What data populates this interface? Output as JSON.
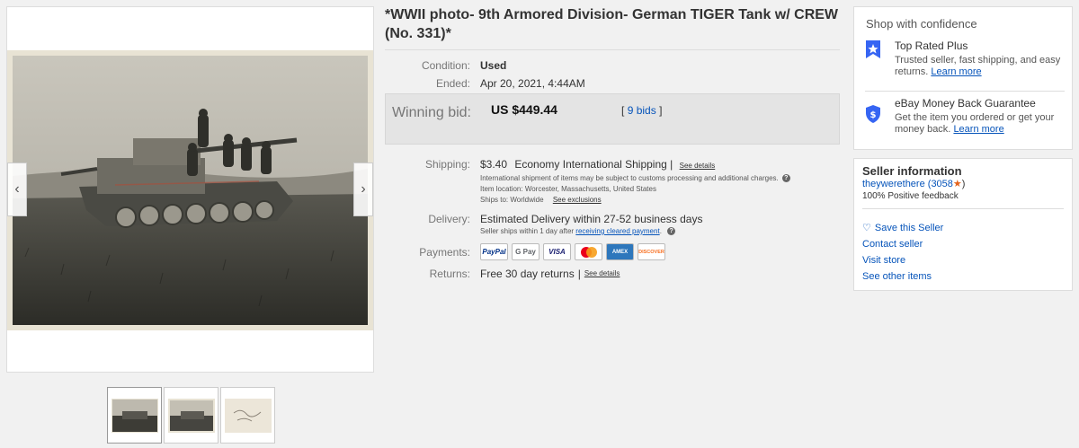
{
  "listing": {
    "title": "*WWII photo- 9th Armored Division- German TIGER Tank w/ CREW (No. 331)*"
  },
  "details": {
    "condition_label": "Condition:",
    "condition_value": "Used",
    "ended_label": "Ended:",
    "ended_value": "Apr 20, 2021, 4:44AM",
    "winning_bid_label": "Winning bid:",
    "winning_bid_value": "US $449.44",
    "bids_open": "[",
    "bids_link": "9 bids",
    "bids_close": "]",
    "shipping_label": "Shipping:",
    "shipping_price": "$3.40",
    "shipping_method": "Economy International Shipping",
    "shipping_sep": "|",
    "shipping_details_link": "See details",
    "shipping_note": "International shipment of items may be subject to customs processing and additional charges.",
    "item_location_label": "Item location:",
    "item_location_value": "Worcester, Massachusetts, United States",
    "ships_to_label": "Ships to:",
    "ships_to_value": "Worldwide",
    "exclusions_link": "See exclusions",
    "delivery_label": "Delivery:",
    "delivery_value": "Estimated Delivery within 27-52 business days",
    "delivery_note_prefix": "Seller ships within 1 day after",
    "delivery_note_link": "receiving cleared payment",
    "delivery_note_suffix": ".",
    "payments_label": "Payments:",
    "payment_methods": [
      "PayPal",
      "G Pay",
      "VISA",
      "Mastercard",
      "AMEX",
      "DISCOVER"
    ],
    "returns_label": "Returns:",
    "returns_value": "Free 30 day returns",
    "returns_sep": "|",
    "returns_details_link": "See details"
  },
  "confidence": {
    "heading": "Shop with confidence",
    "top_rated_title": "Top Rated Plus",
    "top_rated_desc": "Trusted seller, fast shipping, and easy returns.",
    "top_rated_link": "Learn more",
    "guarantee_title": "eBay Money Back Guarantee",
    "guarantee_desc": "Get the item you ordered or get your money back.",
    "guarantee_link": "Learn more"
  },
  "seller": {
    "heading": "Seller information",
    "name": "theywerethere",
    "score": "(3058",
    "score_close": ")",
    "feedback": "100% Positive feedback",
    "save": "Save this Seller",
    "contact": "Contact seller",
    "store": "Visit store",
    "other_items": "See other items"
  },
  "colors": {
    "link": "#0654ba",
    "bid_box": "#e4e4e4",
    "star": "#e4621b"
  }
}
